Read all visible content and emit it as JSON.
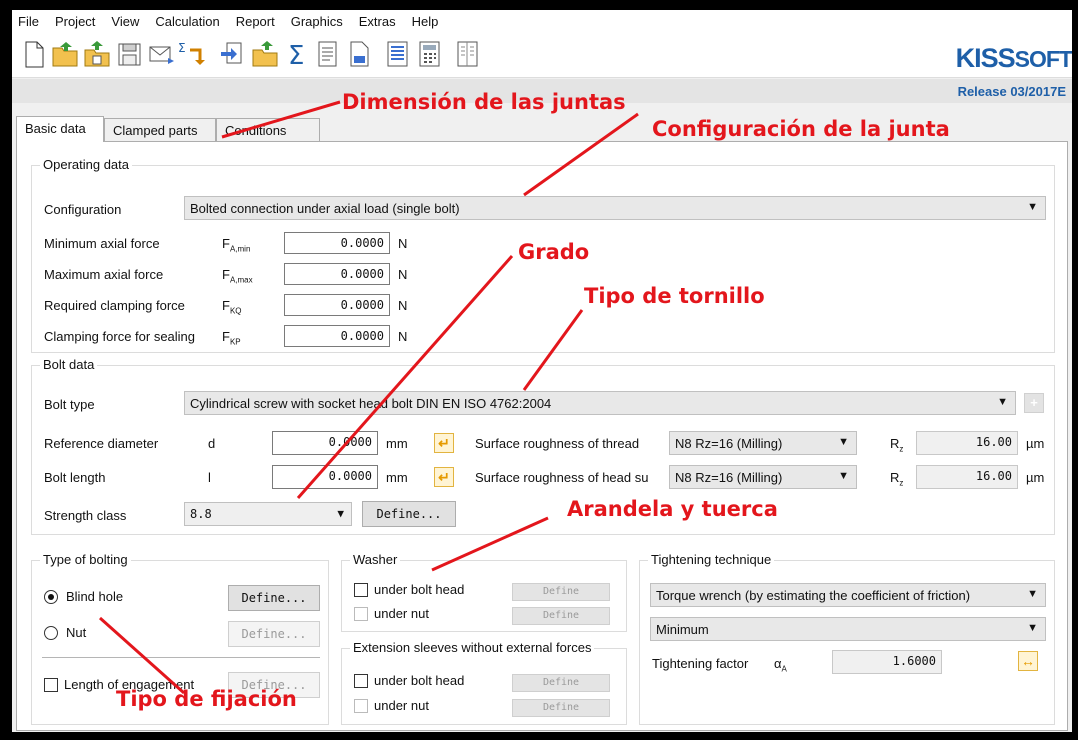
{
  "menu": [
    "File",
    "Project",
    "View",
    "Calculation",
    "Report",
    "Graphics",
    "Extras",
    "Help"
  ],
  "logo": {
    "kiss": "KISS",
    "soft": "SOFT"
  },
  "release": "Release 03/2017E",
  "tabs": [
    "Basic data",
    "Clamped parts",
    "Conditions"
  ],
  "operating": {
    "title": "Operating data",
    "config_label": "Configuration",
    "config_value": "Bolted connection under axial load (single bolt)",
    "rows": [
      {
        "label": "Minimum axial force",
        "sym": "F",
        "sub": "A,min",
        "value": "0.0000",
        "unit": "N"
      },
      {
        "label": "Maximum axial force",
        "sym": "F",
        "sub": "A,max",
        "value": "0.0000",
        "unit": "N"
      },
      {
        "label": "Required clamping force",
        "sym": "F",
        "sub": "KQ",
        "value": "0.0000",
        "unit": "N"
      },
      {
        "label": "Clamping force for sealing",
        "sym": "F",
        "sub": "KP",
        "value": "0.0000",
        "unit": "N"
      }
    ]
  },
  "bolt": {
    "title": "Bolt data",
    "type_label": "Bolt type",
    "type_value": "Cylindrical screw with socket head bolt DIN EN ISO 4762:2004",
    "ref_label": "Reference diameter",
    "ref_sym": "d",
    "ref_value": "0.0000",
    "ref_unit": "mm",
    "len_label": "Bolt length",
    "len_sym": "l",
    "len_value": "0.0000",
    "len_unit": "mm",
    "rough_thread_label": "Surface roughness of thread",
    "rough_thread_value": "N8  Rz=16  (Milling)",
    "rough_head_label": "Surface roughness of head su",
    "rough_head_value": "N8  Rz=16  (Milling)",
    "rz_sym": "R",
    "rz_sub": "z",
    "rz1": "16.00",
    "rz2": "16.00",
    "rz_unit": "µm",
    "strength_label": "Strength class",
    "strength_value": "8.8",
    "define": "Define..."
  },
  "bolting": {
    "title": "Type of bolting",
    "blind": "Blind hole",
    "nut": "Nut",
    "engagement": "Length of engagement",
    "define": "Define..."
  },
  "washer": {
    "title": "Washer",
    "head": "under bolt head",
    "nut": "under nut",
    "define": "Define"
  },
  "sleeves": {
    "title": "Extension sleeves without external forces",
    "head": "under bolt head",
    "nut": "under nut",
    "define": "Define"
  },
  "tightening": {
    "title": "Tightening technique",
    "technique": "Torque wrench (by estimating the coefficient of friction)",
    "level": "Minimum",
    "factor_label": "Tightening factor",
    "factor_sym": "α",
    "factor_sub": "A",
    "factor_value": "1.6000"
  },
  "annotations": {
    "dimension": "Dimensión de las juntas",
    "configuracion": "Configuración de la junta",
    "grado": "Grado",
    "tornillo": "Tipo de tornillo",
    "arandela": "Arandela y tuerca",
    "fijacion": "Tipo de fijación"
  },
  "colors": {
    "annotation": "#e3161c",
    "brand": "#1e5fa8",
    "accent": "#e59a00"
  }
}
